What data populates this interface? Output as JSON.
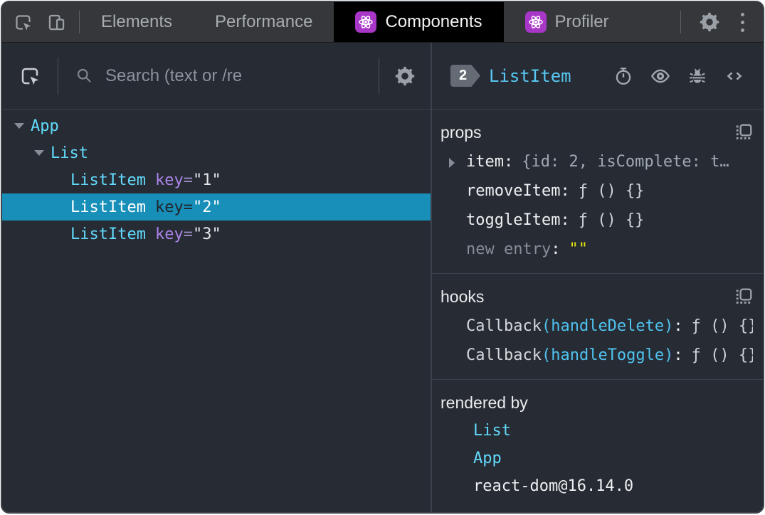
{
  "punct": {
    "colon": ":",
    "eq": "="
  },
  "colors": {
    "selection_blue": "#178fb9",
    "component_cyan": "#61dafb",
    "attr_purple": "#ab84e8",
    "empty_string_yellow": "#e5e510",
    "react_icon_purple": "#a837c8",
    "active_tab_bg": "#000000",
    "toolbar_bg": "#35373a",
    "panel_bg": "#272b33"
  },
  "top_toolbar": {
    "tab_elements": "Elements",
    "tab_performance": "Performance",
    "tab_components": "Components",
    "tab_profiler": "Profiler"
  },
  "left_pane": {
    "search_placeholder": "Search (text or /re",
    "tree": [
      {
        "name": "App"
      },
      {
        "name": "List"
      },
      {
        "name": "ListItem",
        "attr": "key",
        "value": "\"1\""
      },
      {
        "name": "ListItem",
        "attr": "key",
        "value": "\"2\""
      },
      {
        "name": "ListItem",
        "attr": "key",
        "value": "\"3\""
      }
    ]
  },
  "right_pane": {
    "badge": "2",
    "component_name": "ListItem",
    "props": {
      "title": "props",
      "item_name": "item",
      "item_value": "{id: 2, isComplete: t…",
      "remove_name": "removeItem",
      "remove_value": "ƒ () {}",
      "toggle_name": "toggleItem",
      "toggle_value": "ƒ () {}",
      "new_entry_label": "new entry",
      "new_entry_value": "\"\""
    },
    "hooks": {
      "title": "hooks",
      "rows": [
        {
          "fn": "Callback",
          "paren": "(handleDelete)",
          "value": "ƒ () {}"
        },
        {
          "fn": "Callback",
          "paren": "(handleToggle)",
          "value": "ƒ () {}"
        }
      ]
    },
    "rendered_by": {
      "title": "rendered by",
      "items": [
        "List",
        "App",
        "react-dom@16.14.0"
      ]
    }
  }
}
